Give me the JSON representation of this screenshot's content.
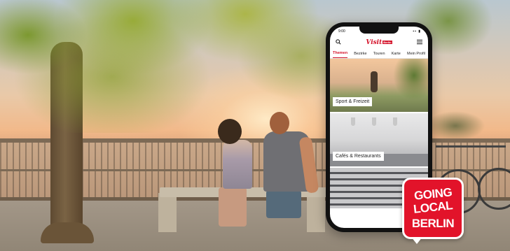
{
  "colors": {
    "brand_red": "#d4132a",
    "badge_red": "#e2132a"
  },
  "phone": {
    "status_time": "9:00",
    "header": {
      "search_icon": "search-icon",
      "menu_icon": "hamburger-menu-icon",
      "logo_text": "Visit",
      "logo_sub": "Berlin"
    },
    "tabs": [
      {
        "label": "Themen",
        "active": true
      },
      {
        "label": "Bezirke",
        "active": false
      },
      {
        "label": "Touren",
        "active": false
      },
      {
        "label": "Karte",
        "active": false
      },
      {
        "label": "Mein Profil",
        "active": false
      }
    ],
    "cards": [
      {
        "label": "Sport & Freizeit"
      },
      {
        "label": "Cafés & Restaurants"
      }
    ]
  },
  "badge": {
    "line1": "GOING",
    "line2": "LOCAL",
    "line3": "BERLIN"
  }
}
